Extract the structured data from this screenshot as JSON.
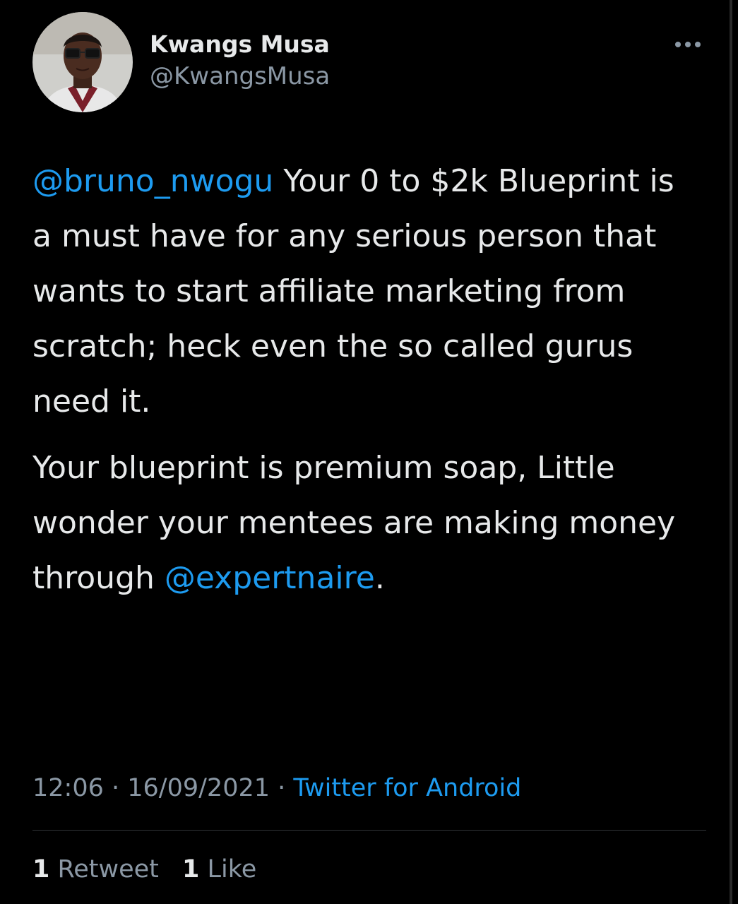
{
  "author": {
    "display_name": "Kwangs Musa",
    "handle": "@KwangsMusa"
  },
  "more_icon": "more-horizontal-icon",
  "tweet": {
    "paragraph1": {
      "mention": "@bruno_nwogu",
      "text": " Your 0 to $2k Blueprint is a must have for any serious person that wants to start affiliate marketing from scratch; heck even the so called gurus need it."
    },
    "paragraph2": {
      "text": "Your blueprint is premium soap, Little wonder your mentees are making money through ",
      "mention": "@expertnaire",
      "trailing": "."
    }
  },
  "meta": {
    "time": "12:06",
    "separator": " · ",
    "date": "16/09/2021",
    "source": "Twitter for Android"
  },
  "stats": {
    "retweets_count": "1",
    "retweets_label": " Retweet",
    "likes_count": "1",
    "likes_label": " Like"
  },
  "colors": {
    "background": "#000000",
    "text": "#e7e9ea",
    "secondary": "#8b98a5",
    "accent": "#1d9bf0",
    "divider": "#2f3336"
  }
}
